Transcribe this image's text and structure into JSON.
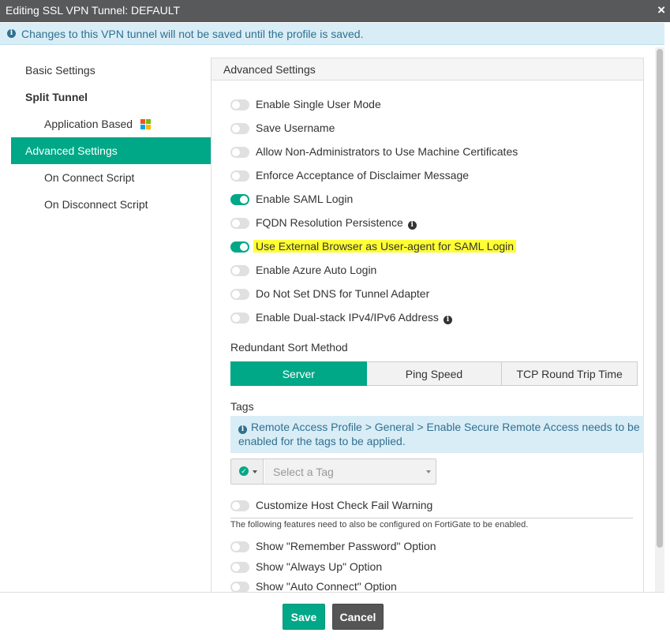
{
  "window": {
    "title": "Editing SSL VPN Tunnel: DEFAULT",
    "close_glyph": "×"
  },
  "notice": {
    "text": "Changes to this VPN tunnel will not be saved until the profile is saved."
  },
  "sidebar": {
    "items": [
      {
        "label": "Basic Settings"
      },
      {
        "label": "Split Tunnel"
      },
      {
        "label": "Application Based",
        "icon": "windows-logo-icon"
      },
      {
        "label": "Advanced Settings",
        "active": true
      },
      {
        "label": "On Connect Script"
      },
      {
        "label": "On Disconnect Script"
      }
    ]
  },
  "panel": {
    "title": "Advanced Settings",
    "options": [
      {
        "label": "Enable Single User Mode",
        "on": false
      },
      {
        "label": "Save Username",
        "on": false
      },
      {
        "label": "Allow Non-Administrators to Use Machine Certificates",
        "on": false
      },
      {
        "label": "Enforce Acceptance of Disclaimer Message",
        "on": false
      },
      {
        "label": "Enable SAML Login",
        "on": true
      },
      {
        "label": "FQDN Resolution Persistence",
        "on": false,
        "info": true
      },
      {
        "label": "Use External Browser as User-agent for SAML Login",
        "on": true,
        "highlighted": true
      },
      {
        "label": "Enable Azure Auto Login",
        "on": false
      },
      {
        "label": "Do Not Set DNS for Tunnel Adapter",
        "on": false
      },
      {
        "label": "Enable Dual-stack IPv4/IPv6 Address",
        "on": false,
        "info": true
      }
    ],
    "sort": {
      "label": "Redundant Sort Method",
      "options": [
        "Server",
        "Ping Speed",
        "TCP Round Trip Time"
      ],
      "selected": "Server"
    },
    "tags": {
      "label": "Tags",
      "info_line1": "Remote Access Profile > General > Enable Secure Remote Access needs to be",
      "info_line2": "enabled for the tags to be applied.",
      "placeholder": "Select a Tag"
    },
    "host_check": {
      "label": "Customize Host Check Fail Warning",
      "on": false
    },
    "fortigate_note": "The following features need to also be configured on FortiGate to be enabled.",
    "extra_options": [
      {
        "label": "Show \"Remember Password\" Option",
        "on": false
      },
      {
        "label": "Show \"Always Up\" Option",
        "on": false
      },
      {
        "label": "Show \"Auto Connect\" Option",
        "on": false
      }
    ]
  },
  "footer": {
    "save_label": "Save",
    "cancel_label": "Cancel"
  },
  "colors": {
    "accent": "#00a887",
    "titlebar": "#58595b",
    "info_bg": "#d9edf7",
    "highlight": "#ffff33"
  }
}
